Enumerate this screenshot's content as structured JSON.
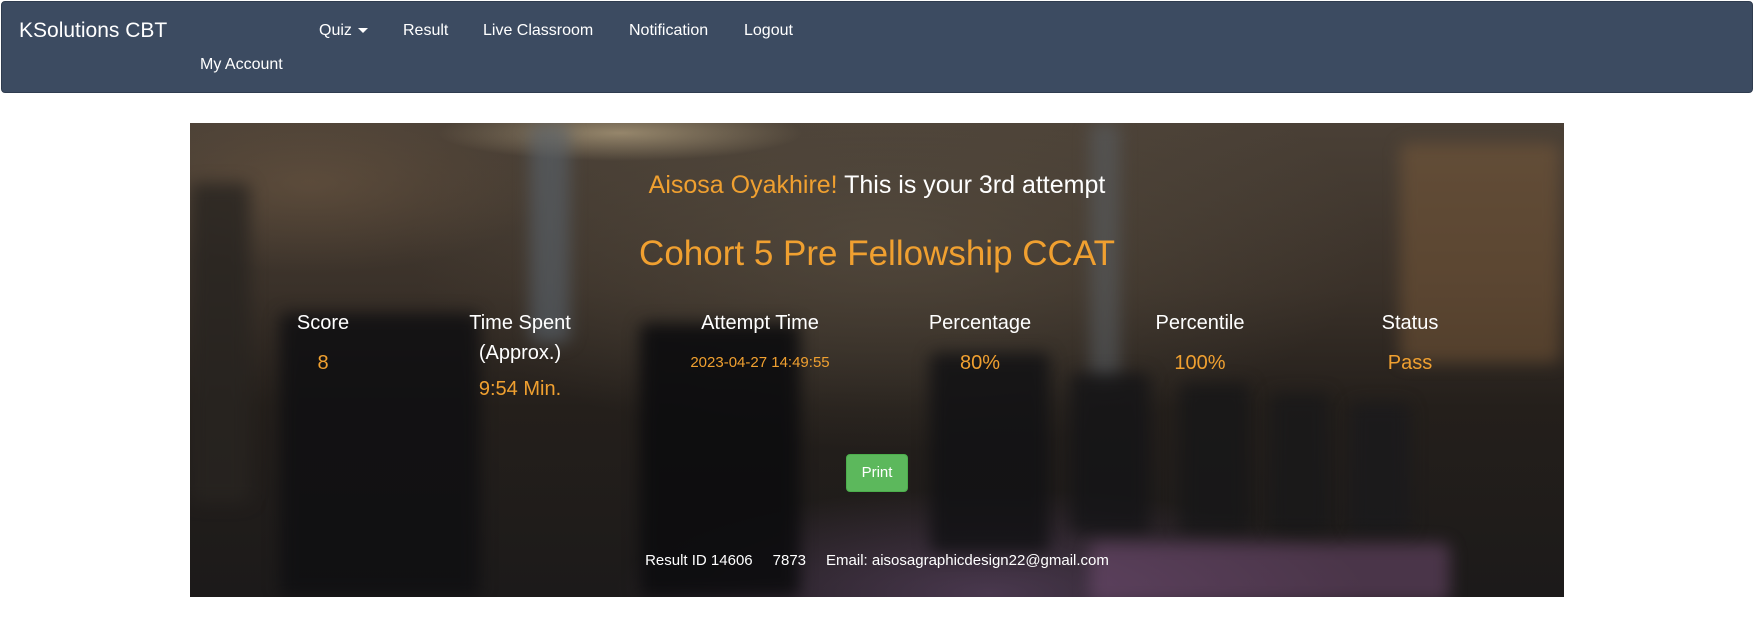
{
  "navbar": {
    "brand": "KSolutions CBT",
    "items": [
      {
        "label": "Quiz"
      },
      {
        "label": "Result"
      },
      {
        "label": "Live Classroom"
      },
      {
        "label": "Notification"
      },
      {
        "label": "Logout"
      },
      {
        "label": "My Account"
      }
    ]
  },
  "result": {
    "user_name": "Aisosa Oyakhire!",
    "attempt_text": "This is your 3rd attempt",
    "quiz_title": "Cohort 5 Pre Fellowship CCAT",
    "stats": {
      "score": {
        "label": "Score",
        "value": "8"
      },
      "time_spent": {
        "label_line1": "Time Spent",
        "label_line2": "(Approx.)",
        "value": "9:54 Min."
      },
      "attempt_time": {
        "label": "Attempt Time",
        "value": "2023-04-27 14:49:55"
      },
      "percentage": {
        "label": "Percentage",
        "value": "80%"
      },
      "percentile": {
        "label": "Percentile",
        "value": "100%"
      },
      "status": {
        "label": "Status",
        "value": "Pass"
      }
    },
    "print_label": "Print",
    "footer": {
      "result_id": "Result ID 14606",
      "code": "7873",
      "email": "Email: aisosagraphicdesign22@gmail.com"
    }
  },
  "colors": {
    "navbar_bg": "#3c4b61",
    "accent_orange": "#f0a030",
    "print_green": "#5cb85c"
  }
}
